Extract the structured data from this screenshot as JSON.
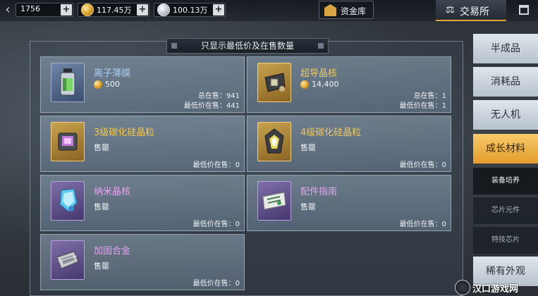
{
  "topbar": {
    "currencies": [
      {
        "icon": "energy-icon",
        "value": "1756"
      },
      {
        "icon": "gold-coin-icon",
        "value": "117.45万"
      },
      {
        "icon": "silver-coin-icon",
        "value": "100.13万"
      }
    ],
    "vault_label": "资金库",
    "tabs": [
      {
        "label": "交易所",
        "active": true
      },
      {
        "label": "",
        "active": false
      }
    ]
  },
  "panel": {
    "notice": "只显示最低价及在售数量",
    "items": [
      {
        "name": "离子薄膜",
        "quality": "blue",
        "price": "500",
        "soldout": "",
        "total_label": "总在售：941",
        "lowest_label": "最低价在售：441"
      },
      {
        "name": "超导晶核",
        "quality": "gold",
        "price": "14,400",
        "soldout": "",
        "total_label": "总在售：1",
        "lowest_label": "最低价在售：1"
      },
      {
        "name": "3级碳化硅晶粒",
        "quality": "gold",
        "price": "",
        "soldout": "售罄",
        "total_label": "",
        "lowest_label": "最低价在售：0"
      },
      {
        "name": "4级碳化硅晶粒",
        "quality": "gold",
        "price": "",
        "soldout": "售罄",
        "total_label": "",
        "lowest_label": "最低价在售：0"
      },
      {
        "name": "纳米晶核",
        "quality": "purple",
        "price": "",
        "soldout": "售罄",
        "total_label": "",
        "lowest_label": "最低价在售：0"
      },
      {
        "name": "配件指南",
        "quality": "purple",
        "price": "",
        "soldout": "售罄",
        "total_label": "",
        "lowest_label": "最低价在售：0"
      },
      {
        "name": "加固合金",
        "quality": "purple",
        "price": "",
        "soldout": "售罄",
        "total_label": "",
        "lowest_label": "最低价在售：0"
      }
    ]
  },
  "categories": [
    {
      "label": "半成品",
      "type": "main",
      "active": false
    },
    {
      "label": "消耗品",
      "type": "main",
      "active": false
    },
    {
      "label": "无人机",
      "type": "main",
      "active": false
    },
    {
      "label": "成长材料",
      "type": "main",
      "active": true
    },
    {
      "label": "装备培养",
      "type": "sub",
      "active": true
    },
    {
      "label": "芯片元件",
      "type": "sub",
      "active": false
    },
    {
      "label": "特技芯片",
      "type": "sub",
      "active": false
    },
    {
      "label": "稀有外观",
      "type": "main",
      "active": false
    }
  ],
  "watermark": "汉口游戏网",
  "colors": {
    "accent": "#e49c2c",
    "blue_name": "#a8ccf2",
    "gold_name": "#f2c94f",
    "purple_name": "#e0a6ee"
  }
}
